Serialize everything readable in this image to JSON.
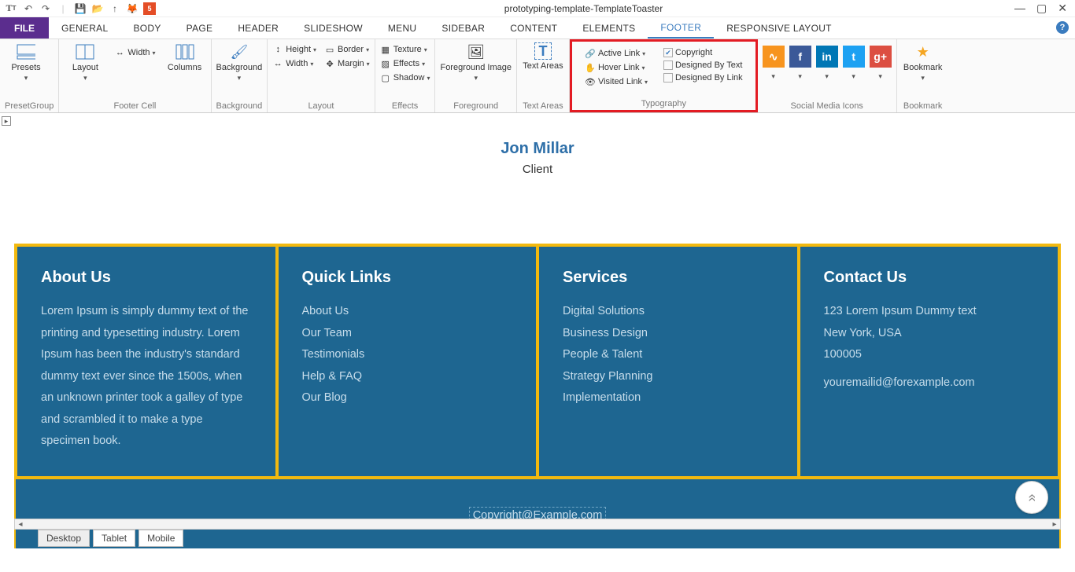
{
  "window": {
    "title": "prototyping-template-TemplateToaster"
  },
  "menu": {
    "file": "FILE",
    "tabs": [
      "GENERAL",
      "BODY",
      "PAGE",
      "HEADER",
      "SLIDESHOW",
      "MENU",
      "SIDEBAR",
      "CONTENT",
      "ELEMENTS",
      "FOOTER",
      "RESPONSIVE LAYOUT"
    ],
    "active": "FOOTER"
  },
  "ribbon": {
    "presets": {
      "label": "Presets",
      "group": "PresetGroup"
    },
    "footercell": {
      "layout": "Layout",
      "width": "Width",
      "columns": "Columns",
      "group": "Footer Cell"
    },
    "background": {
      "label": "Background",
      "group": "Background"
    },
    "layout": {
      "height": "Height",
      "border": "Border",
      "width": "Width",
      "margin": "Margin",
      "group": "Layout"
    },
    "effects": {
      "texture": "Texture",
      "effects": "Effects",
      "shadow": "Shadow",
      "group": "Effects"
    },
    "foreground": {
      "label": "Foreground Image",
      "group": "Foreground"
    },
    "textareas": {
      "label": "Text Areas",
      "group": "Text Areas"
    },
    "typography": {
      "active": "Active Link",
      "hover": "Hover Link",
      "visited": "Visited Link",
      "copyright": "Copyright",
      "designed_text": "Designed By Text",
      "designed_link": "Designed By Link",
      "group": "Typography"
    },
    "social": {
      "group": "Social Media Icons"
    },
    "bookmark": {
      "label": "Bookmark",
      "group": "Bookmark"
    }
  },
  "doc": {
    "name": "Jon Millar",
    "role": "Client"
  },
  "footer": {
    "about": {
      "title": "About Us",
      "text": "Lorem Ipsum is simply dummy text of the printing and typesetting industry. Lorem Ipsum has been the industry's standard dummy text ever since the 1500s, when an unknown printer took a galley of type and scrambled it to make a type specimen book."
    },
    "quick": {
      "title": "Quick Links",
      "items": [
        "About Us",
        "Our Team",
        "Testimonials",
        "Help & FAQ",
        "Our Blog"
      ]
    },
    "services": {
      "title": "Services",
      "items": [
        "Digital Solutions",
        "Business Design",
        "People & Talent",
        "Strategy Planning",
        "Implementation"
      ]
    },
    "contact": {
      "title": "Contact Us",
      "lines": [
        "123 Lorem Ipsum Dummy text",
        "New York, USA",
        "100005"
      ],
      "email": "youremailid@forexample.com"
    },
    "copyright": "Copyright@Example.com"
  },
  "devices": {
    "tabs": [
      "Desktop",
      "Tablet",
      "Mobile"
    ],
    "active": "Desktop"
  }
}
